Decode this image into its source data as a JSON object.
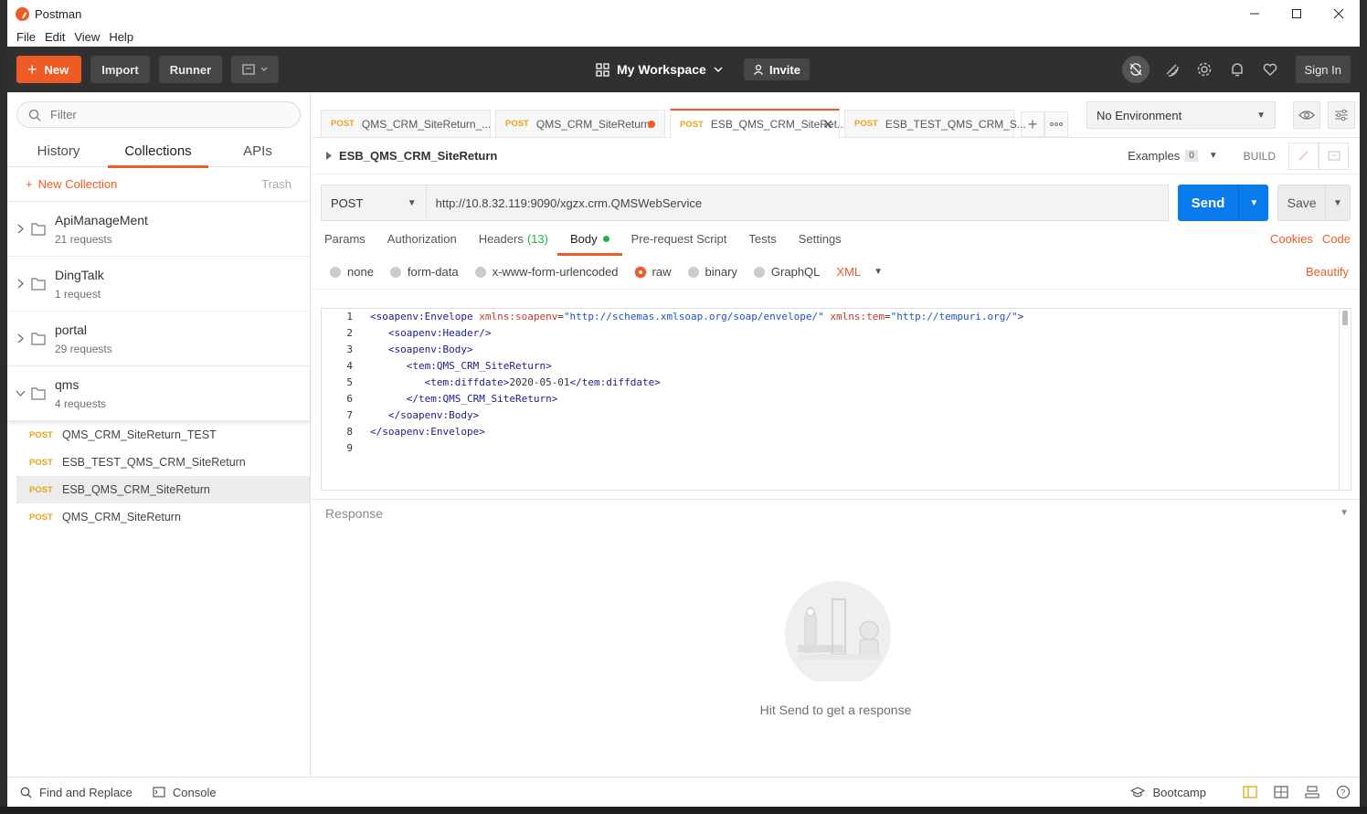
{
  "window": {
    "title": "Postman",
    "menu": [
      "File",
      "Edit",
      "View",
      "Help"
    ]
  },
  "header": {
    "new_label": "New",
    "import_label": "Import",
    "runner_label": "Runner",
    "workspace_label": "My Workspace",
    "invite_label": "Invite",
    "sign_in_label": "Sign In"
  },
  "sidebar": {
    "filter_placeholder": "Filter",
    "tabs": [
      "History",
      "Collections",
      "APIs"
    ],
    "active_tab": "Collections",
    "new_collection_label": "New Collection",
    "trash_label": "Trash",
    "collections": [
      {
        "name": "ApiManageMent",
        "count": "21 requests"
      },
      {
        "name": "DingTalk",
        "count": "1 request"
      },
      {
        "name": "portal",
        "count": "29 requests"
      },
      {
        "name": "qms",
        "count": "4 requests"
      }
    ],
    "requests": [
      {
        "method": "POST",
        "name": "QMS_CRM_SiteReturn_TEST"
      },
      {
        "method": "POST",
        "name": "ESB_TEST_QMS_CRM_SiteReturn"
      },
      {
        "method": "POST",
        "name": "ESB_QMS_CRM_SiteReturn"
      },
      {
        "method": "POST",
        "name": "QMS_CRM_SiteReturn"
      }
    ]
  },
  "tabs": [
    {
      "method": "POST",
      "name": "QMS_CRM_SiteReturn_..."
    },
    {
      "method": "POST",
      "name": "QMS_CRM_SiteReturn"
    },
    {
      "method": "POST",
      "name": "ESB_QMS_CRM_SiteRet..."
    },
    {
      "method": "POST",
      "name": "ESB_TEST_QMS_CRM_S..."
    }
  ],
  "environment": {
    "selected": "No Environment"
  },
  "request": {
    "name": "ESB_QMS_CRM_SiteReturn",
    "examples_label": "Examples",
    "examples_count": "0",
    "build_label": "BUILD",
    "method": "POST",
    "url": "http://10.8.32.119:9090/xgzx.crm.QMSWebService",
    "send_label": "Send",
    "save_label": "Save",
    "subtabs": {
      "params": "Params",
      "authorization": "Authorization",
      "headers": "Headers",
      "headers_count": "(13)",
      "body": "Body",
      "prerequest": "Pre-request Script",
      "tests": "Tests",
      "settings": "Settings"
    },
    "cookies_label": "Cookies",
    "code_label": "Code",
    "body_types": [
      "none",
      "form-data",
      "x-www-form-urlencoded",
      "raw",
      "binary",
      "GraphQL"
    ],
    "body_format": "XML",
    "beautify_label": "Beautify",
    "line_numbers": [
      "1",
      "2",
      "3",
      "4",
      "5",
      "6",
      "7",
      "8",
      "9"
    ],
    "code": {
      "l1_open": "<soapenv:Envelope ",
      "l1_attr1": "xmlns:soapenv",
      "l1_val1": "\"http://schemas.xmlsoap.org/soap/envelope/\"",
      "l1_attr2": "xmlns:tem",
      "l1_val2": "\"http://tempuri.org/\"",
      "l2": "<soapenv:Header/>",
      "l3": "<soapenv:Body>",
      "l4": "<tem:QMS_CRM_SiteReturn>",
      "l5_open": "<tem:diffdate>",
      "l5_text": "2020-05-01",
      "l5_close": "</tem:diffdate>",
      "l6": "</tem:QMS_CRM_SiteReturn>",
      "l7": "</soapenv:Body>",
      "l8": "</soapenv:Envelope>"
    }
  },
  "response": {
    "title": "Response",
    "empty_text": "Hit Send to get a response"
  },
  "statusbar": {
    "find_replace": "Find and Replace",
    "console": "Console",
    "bootcamp": "Bootcamp"
  }
}
